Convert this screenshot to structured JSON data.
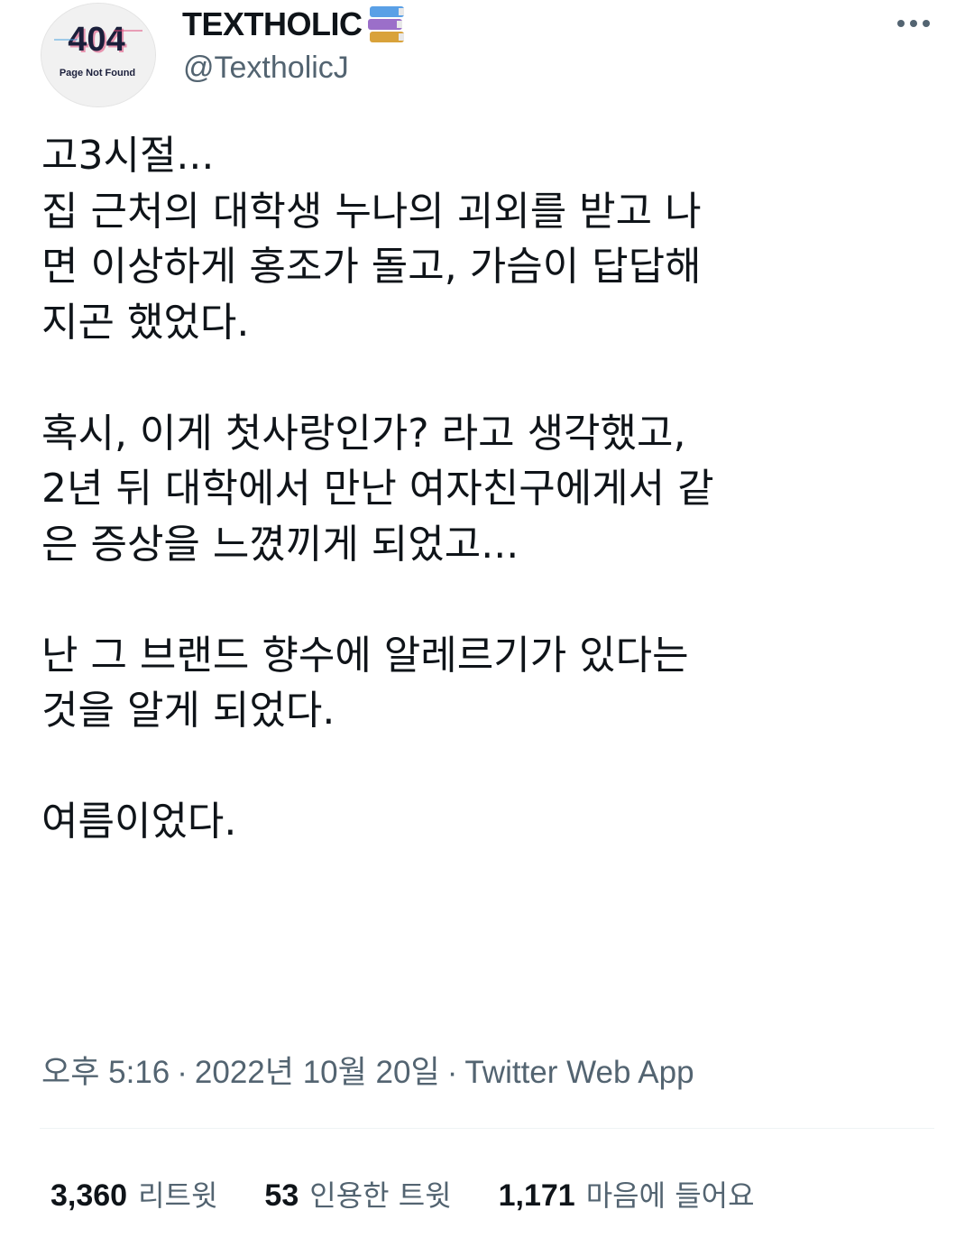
{
  "author": {
    "avatar_text_main": "404",
    "avatar_text_sub": "Page Not Found",
    "display_name": "TEXTHOLIC",
    "name_emoji": "books-icon",
    "handle": "@TextholicJ"
  },
  "tweet": {
    "lines": [
      "고3시절...",
      "집 근처의 대학생 누나의 괴외를 받고 나",
      "면 이상하게 홍조가 돌고, 가슴이 답답해",
      "지곤 했었다.",
      "",
      "혹시, 이게 첫사랑인가? 라고 생각했고,",
      "2년 뒤 대학에서 만난 여자친구에게서 같",
      "은 증상을 느꼈끼게 되었고...",
      "",
      "난 그 브랜드 향수에 알레르기가 있다는",
      "것을 알게 되었다.",
      "",
      "여름이었다."
    ]
  },
  "meta": {
    "time": "오후 5:16",
    "separator": "·",
    "date": "2022년 10월 20일",
    "source": "Twitter Web App"
  },
  "stats": {
    "retweets": {
      "count": "3,360",
      "label": "리트윗"
    },
    "quotes": {
      "count": "53",
      "label": "인용한 트윗"
    },
    "likes": {
      "count": "1,171",
      "label": "마음에 들어요"
    }
  },
  "icons": {
    "more": "more-horizontal-icon"
  },
  "colors": {
    "text_primary": "#0f1419",
    "text_secondary": "#536471",
    "divider": "#eff3f4"
  }
}
